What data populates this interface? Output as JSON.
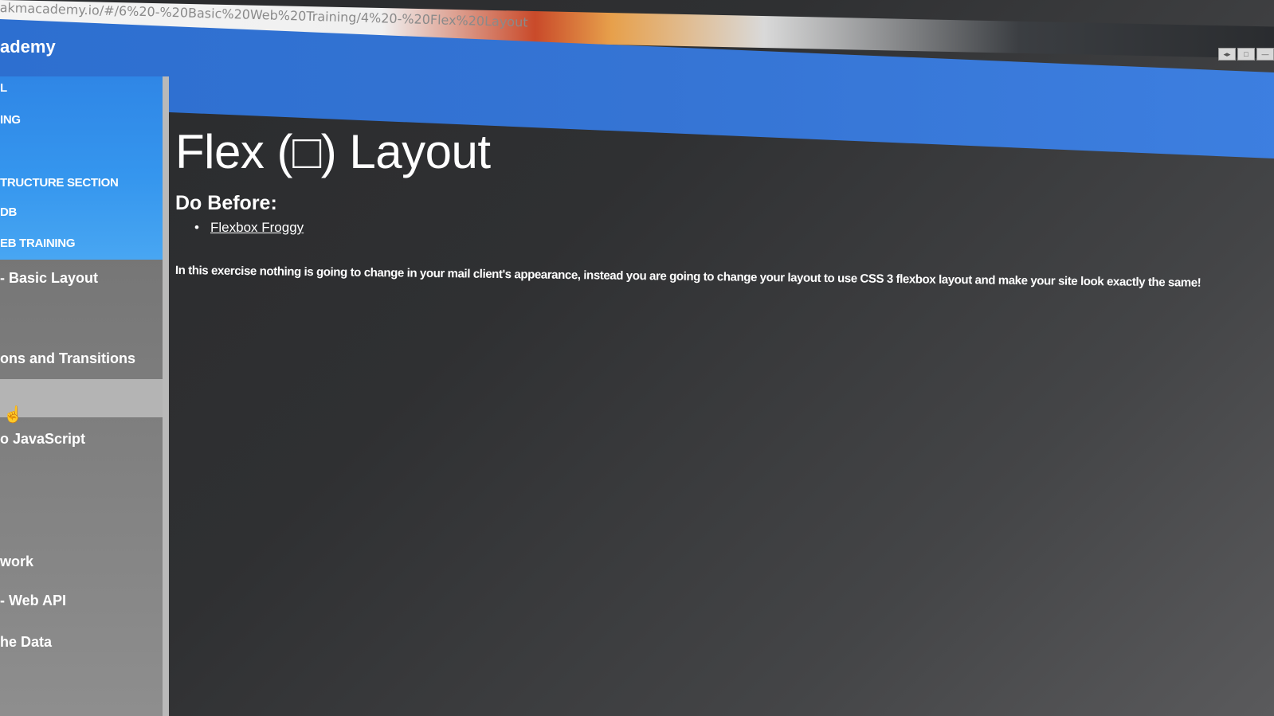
{
  "browser": {
    "url": "akmacademy.io/#/6%20-%20Basic%20Web%20Training/4%20-%20Flex%20Layout"
  },
  "header": {
    "app_title": "ademy"
  },
  "sidebar": {
    "top_items": [
      {
        "label": "L"
      },
      {
        "label": "ING"
      },
      {
        "label": "TRUCTURE SECTION"
      },
      {
        "label": "DB"
      },
      {
        "label": "EB TRAINING"
      }
    ],
    "items": [
      {
        "label": "- Basic Layout"
      },
      {
        "label": "ons and Transitions"
      },
      {
        "label": ""
      },
      {
        "label": "o JavaScript"
      },
      {
        "label": "work"
      },
      {
        "label": "- Web API"
      },
      {
        "label": "he Data"
      }
    ]
  },
  "main": {
    "title": "Flex (□) Layout",
    "subheading": "Do Before:",
    "links": [
      {
        "label": "Flexbox Froggy"
      }
    ],
    "exercise_text": "In this exercise nothing is going to change in your mail client's appearance, instead you are going to change your layout to use CSS 3 flexbox layout and make your site look exactly the same!"
  },
  "icons": {
    "cursor": "hand-pointer-icon",
    "window_controls": [
      "restore-icon",
      "maximize-icon",
      "minimize-icon"
    ]
  }
}
